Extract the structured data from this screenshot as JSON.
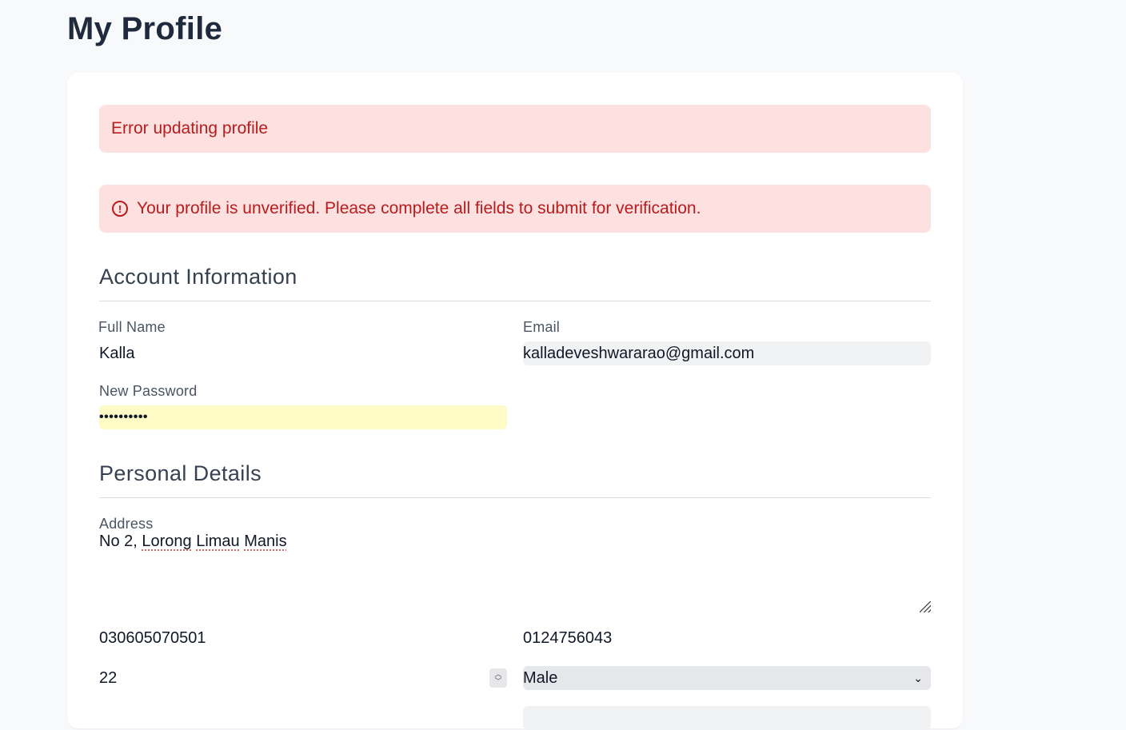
{
  "page": {
    "title": "My Profile"
  },
  "alerts": {
    "error": "Error updating profile",
    "warning": "Your profile is unverified. Please complete all fields to submit for verification."
  },
  "account": {
    "section_title": "Account Information",
    "full_name_label": "Full Name",
    "full_name_value": "Kalla",
    "email_label": "Email",
    "email_value": "kalladeveshwararao@gmail.com",
    "password_label": "New Password",
    "password_value": "••••••••••"
  },
  "personal": {
    "section_title": "Personal Details",
    "address_label": "Address",
    "address_prefix": "No 2, ",
    "address_words": [
      "Lorong",
      "Limau",
      "Manis"
    ],
    "id_number": "030605070501",
    "phone": "0124756043",
    "age": "22",
    "gender": "Male"
  },
  "colors": {
    "alert_bg": "#fde0e0",
    "alert_text": "#b91c1c",
    "password_bg": "#fefbc6",
    "readonly_bg": "#f1f2f4"
  }
}
